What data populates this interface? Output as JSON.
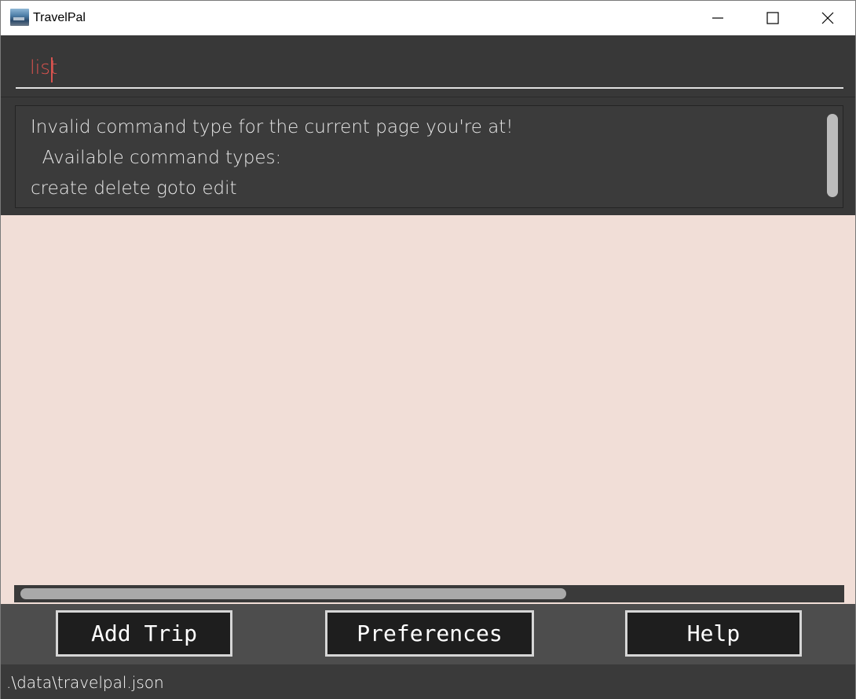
{
  "window": {
    "title": "TravelPal"
  },
  "command_box": {
    "value": "list"
  },
  "result_display": {
    "lines": [
      "Invalid command type for the current page you're at!",
      "  Available command types:",
      "create delete goto edit"
    ]
  },
  "buttons": {
    "add_trip": "Add Trip",
    "preferences": "Preferences",
    "help": "Help"
  },
  "status_bar": {
    "path": ".\\data\\travelpal.json"
  },
  "colors": {
    "command_text": "#d9534f",
    "panel_background": "#f1ded7",
    "dark_background": "#383838"
  }
}
